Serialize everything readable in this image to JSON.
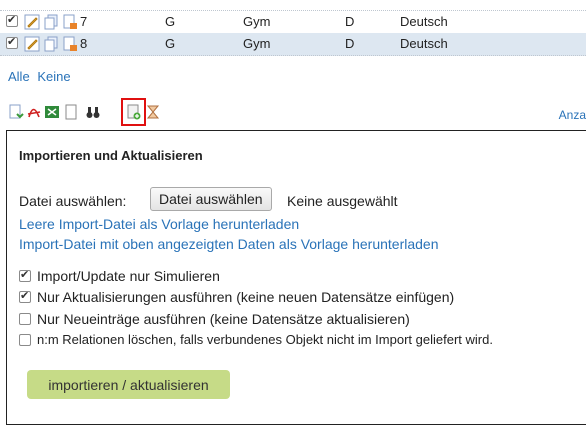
{
  "rows": [
    {
      "num": "7",
      "col1": "G",
      "col2": "Gym",
      "col3": "D",
      "col4": "Deutsch"
    },
    {
      "num": "8",
      "col1": "G",
      "col2": "Gym",
      "col3": "D",
      "col4": "Deutsch"
    }
  ],
  "select_links": {
    "all": "Alle",
    "none": "Keine"
  },
  "toolbar": {
    "icons": [
      "export-icon",
      "pdf-icon",
      "excel-icon",
      "page-icon",
      "binoculars-icon",
      "import-icon",
      "sort-icon"
    ],
    "right_label": "Anza"
  },
  "panel": {
    "title": "Importieren und Aktualisieren",
    "file_label": "Datei auswählen:",
    "file_button": "Datei auswählen",
    "file_status": "Keine ausgewählt",
    "download_empty": "Leere Import-Datei als Vorlage herunterladen",
    "download_data": "Import-Datei mit oben angezeigten Daten als Vorlage herunterladen",
    "options": [
      {
        "label": "Import/Update nur Simulieren",
        "checked": true
      },
      {
        "label": "Nur Aktualisierungen ausführen (keine neuen Datensätze einfügen)",
        "checked": true
      },
      {
        "label": "Nur Neueinträge ausführen (keine Datensätze aktualisieren)",
        "checked": false
      },
      {
        "label": "n:m Relationen löschen, falls verbundenes Objekt nicht im Import geliefert wird.",
        "checked": false
      }
    ],
    "submit": "importieren / aktualisieren"
  }
}
